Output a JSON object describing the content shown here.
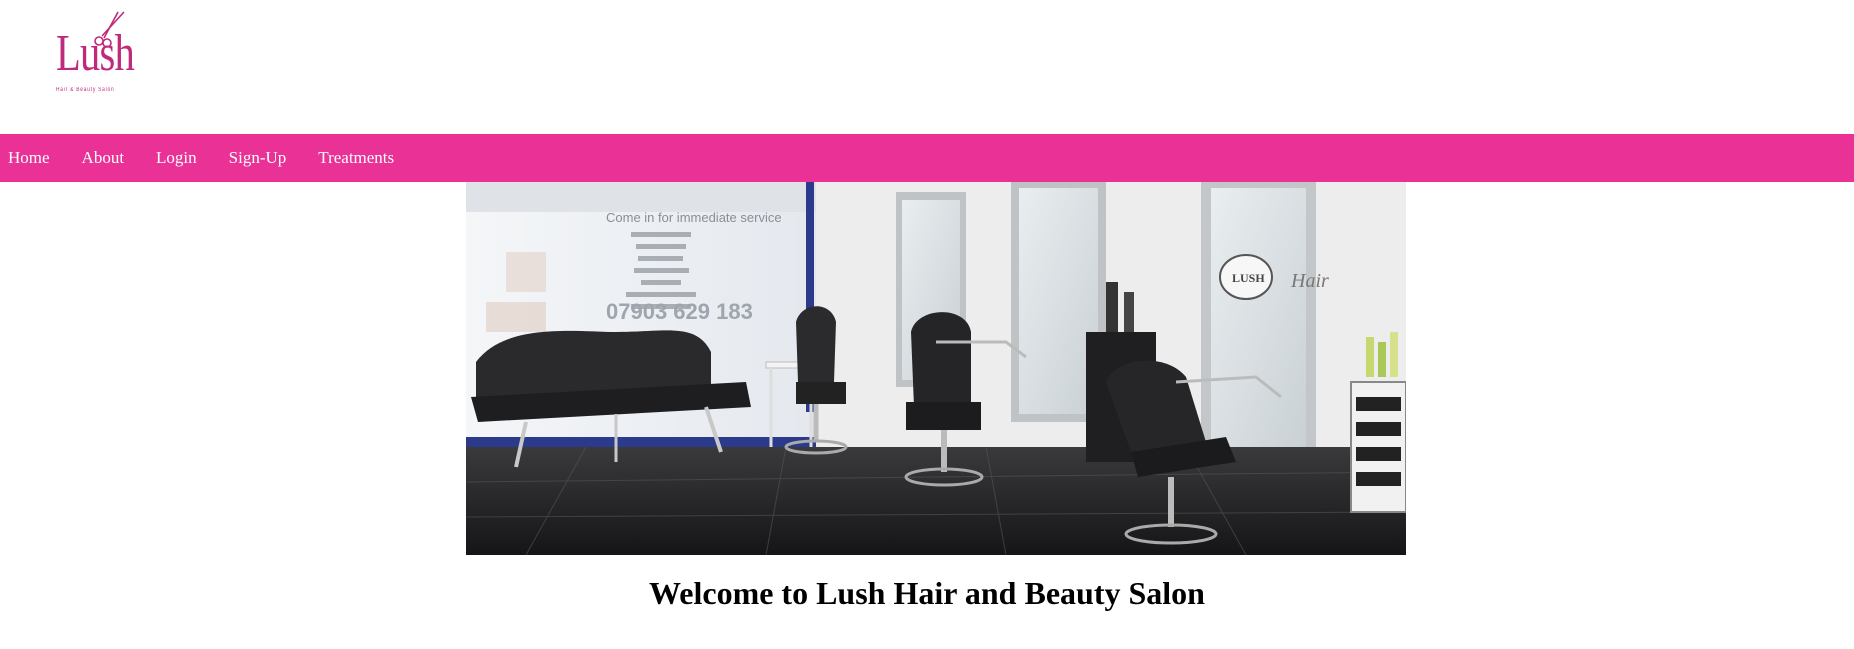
{
  "logo": {
    "word": "Lush",
    "tagline": "Hair & Beauty Salon",
    "icon": "scissors-icon",
    "color": "#c02a7c"
  },
  "nav": {
    "color": "#e93196",
    "items": [
      {
        "label": "Home"
      },
      {
        "label": "About"
      },
      {
        "label": "Login"
      },
      {
        "label": "Sign-Up"
      },
      {
        "label": "Treatments"
      }
    ]
  },
  "hero": {
    "window_text": "Come in for immediate service",
    "window_phone": "07903 629 183",
    "mirror_logo": "LUSH",
    "mirror_script": "Hair"
  },
  "main": {
    "heading": "Welcome to Lush Hair and Beauty Salon"
  }
}
